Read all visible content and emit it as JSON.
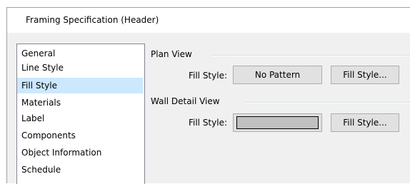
{
  "window": {
    "title": "Framing Specification (Header)"
  },
  "sidebar": {
    "items": [
      {
        "label": "General",
        "selected": false
      },
      {
        "label": "Line Style",
        "selected": false
      },
      {
        "label": "Fill Style",
        "selected": true
      },
      {
        "label": "Materials",
        "selected": false
      },
      {
        "label": "Label",
        "selected": false
      },
      {
        "label": "Components",
        "selected": false
      },
      {
        "label": "Object Information",
        "selected": false
      },
      {
        "label": "Schedule",
        "selected": false
      }
    ]
  },
  "plan_view": {
    "group_title": "Plan View",
    "fill_style_label": "Fill Style:",
    "fill_value": "No Pattern",
    "fill_style_button": "Fill Style..."
  },
  "wall_detail_view": {
    "group_title": "Wall Detail View",
    "fill_style_label": "Fill Style:",
    "swatch_color": "#c0c0c0",
    "fill_style_button": "Fill Style..."
  },
  "colors": {
    "selection": "#cce8ff",
    "button_face": "#e1e1e1",
    "dialog_bg": "#f0f0f0"
  }
}
